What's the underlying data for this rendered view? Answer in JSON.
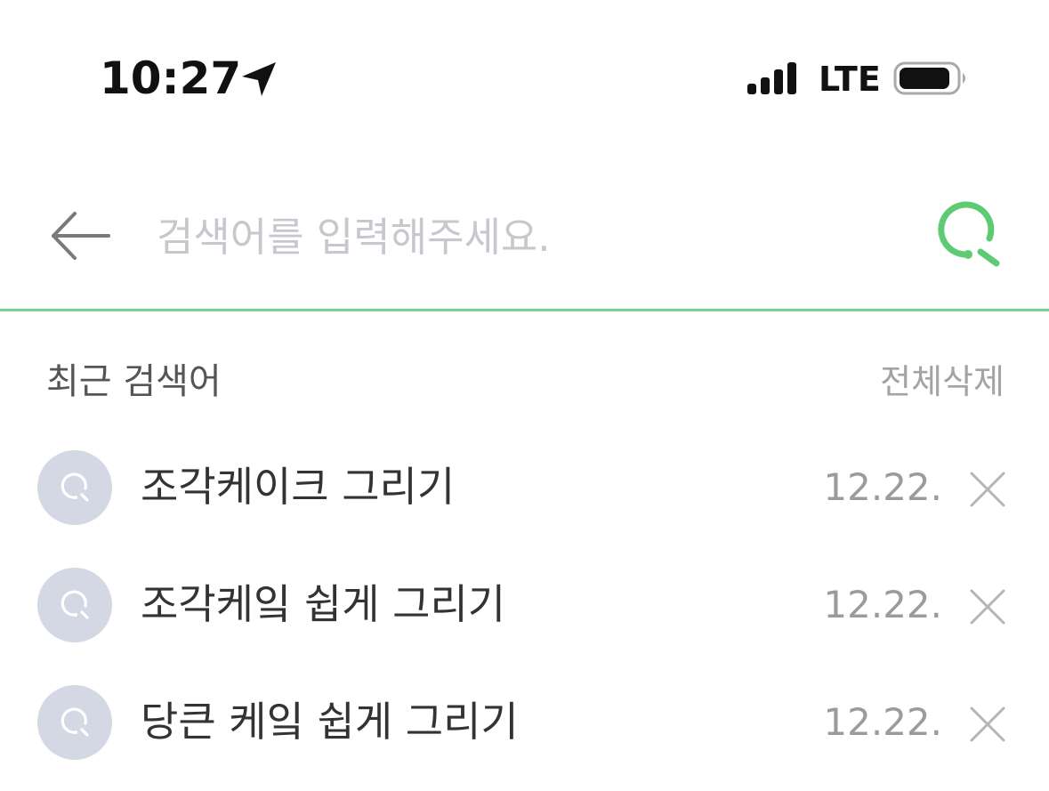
{
  "status_bar": {
    "time": "10:27",
    "network": "LTE",
    "icons": [
      "location-arrow-icon",
      "signal-bars-icon",
      "battery-icon"
    ]
  },
  "search": {
    "placeholder": "검색어를 입력해주세요.",
    "value": ""
  },
  "recent": {
    "title": "최근 검색어",
    "delete_all_label": "전체삭제",
    "items": [
      {
        "text": "조각케이크 그리기",
        "date": "12.22."
      },
      {
        "text": "조각케잌 쉽게 그리기",
        "date": "12.22."
      },
      {
        "text": "당큰 케잌 쉽게 그리기",
        "date": "12.22."
      }
    ]
  },
  "colors": {
    "accent": "#5ecb74",
    "divider": "#7fd08e",
    "recent_icon_bg": "#d3d8e4",
    "placeholder": "#c6c8cd",
    "text_muted": "#9b9b9b"
  }
}
